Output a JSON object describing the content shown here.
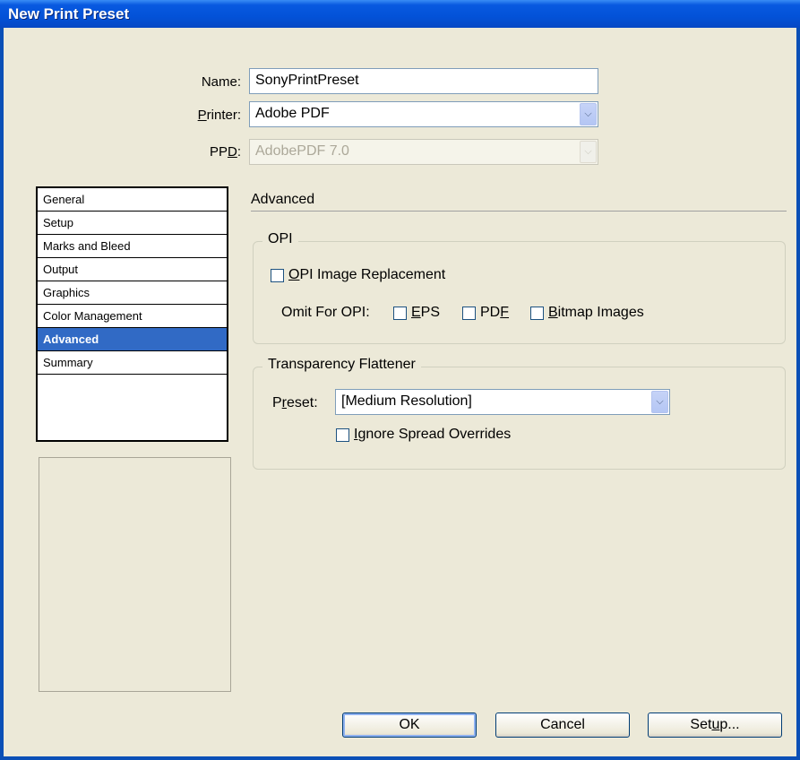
{
  "window": {
    "title": "New Print Preset"
  },
  "form": {
    "name_label": "Name:",
    "name_value": "SonyPrintPreset",
    "printer_label": "Printer:",
    "printer_value": "Adobe PDF",
    "ppd_label": "PPD:",
    "ppd_value": "AdobePDF 7.0"
  },
  "nav": {
    "items": [
      {
        "label": "General"
      },
      {
        "label": "Setup"
      },
      {
        "label": "Marks and Bleed"
      },
      {
        "label": "Output"
      },
      {
        "label": "Graphics"
      },
      {
        "label": "Color Management"
      },
      {
        "label": "Advanced",
        "selected": true
      },
      {
        "label": "Summary"
      }
    ]
  },
  "main": {
    "section_title": "Advanced",
    "opi": {
      "title": "OPI",
      "image_replacement": {
        "label": "OPI Image Replacement",
        "checked": false
      },
      "omit_label": "Omit For OPI:",
      "eps": {
        "label": "EPS",
        "checked": false
      },
      "pdf": {
        "label": "PDF",
        "checked": false
      },
      "bitmap": {
        "label": "Bitmap Images",
        "checked": false
      }
    },
    "flattener": {
      "title": "Transparency Flattener",
      "preset_label": "Preset:",
      "preset_value": "[Medium Resolution]",
      "ignore_overrides": {
        "label": "Ignore Spread Overrides",
        "checked": false
      }
    }
  },
  "buttons": {
    "ok": "OK",
    "cancel": "Cancel",
    "setup": "Setup..."
  },
  "icons": {
    "dropdown": "chevron-down-icon",
    "checkbox": "checkbox-icon"
  },
  "colors": {
    "titlebar": "#0352d8",
    "selection": "#316ac5",
    "dialog_bg": "#ece9d8"
  }
}
